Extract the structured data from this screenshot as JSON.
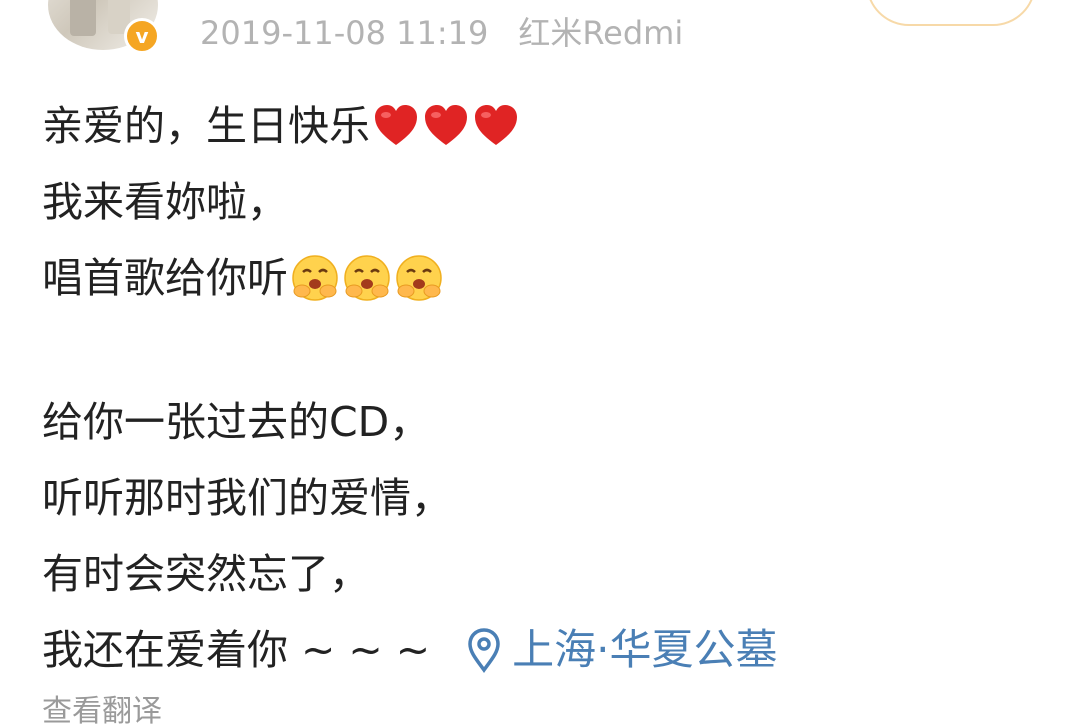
{
  "post": {
    "timestamp": "2019-11-08 11:19",
    "device": "红米Redmi",
    "verified_badge": "v",
    "lines": [
      "亲爱的，生日快乐",
      "我来看妳啦，",
      "唱首歌给你听",
      "",
      "给你一张过去的CD，",
      "听听那时我们的爱情，",
      "有时会突然忘了，",
      "我还在爱着你 ~ ~ ~"
    ],
    "emoji": {
      "hearts": [
        "red-heart",
        "red-heart",
        "red-heart"
      ],
      "faces": [
        "hug-face",
        "hug-face",
        "hug-face"
      ]
    },
    "location": "上海·华夏公墓",
    "translate_label": "查看翻译"
  },
  "colors": {
    "text": "#222222",
    "meta": "#b3b3b3",
    "location": "#4a7fb5",
    "badge": "#f5a623",
    "heart": "#e02424"
  }
}
